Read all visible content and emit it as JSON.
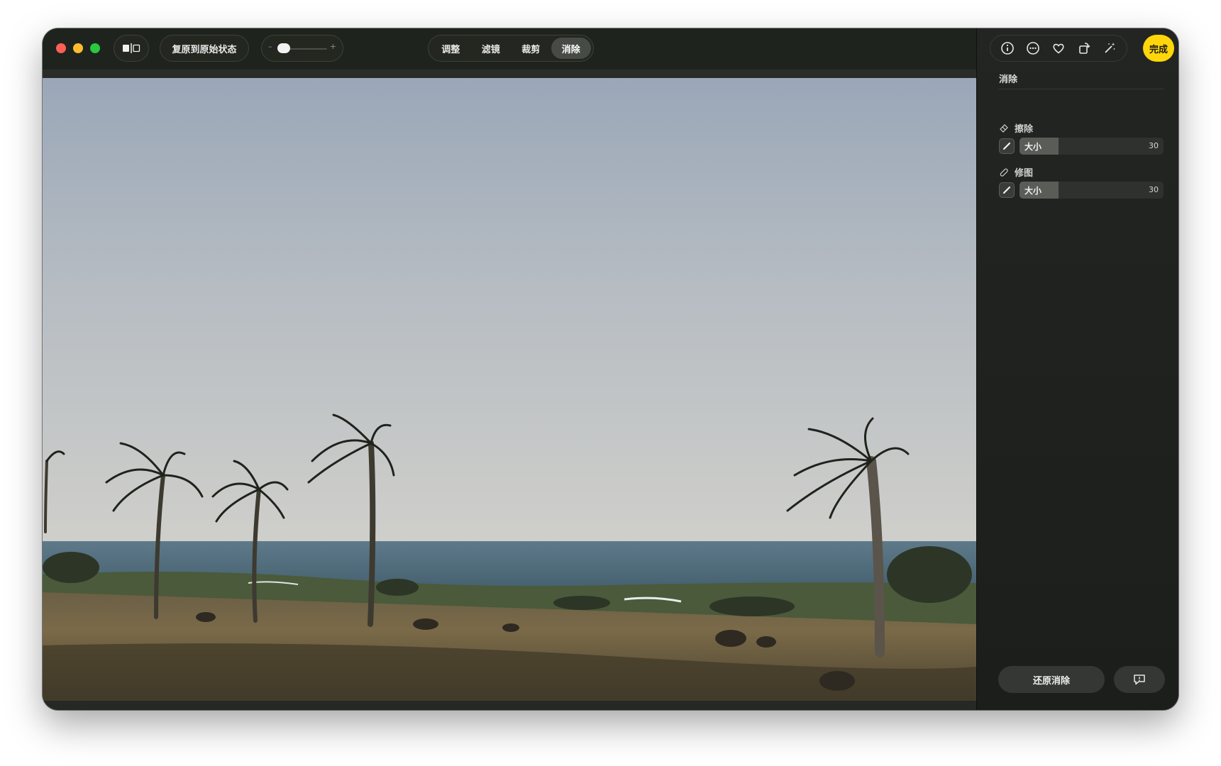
{
  "toolbar": {
    "revert_label": "复原到原始状态",
    "zoom": {
      "minus": "–",
      "plus": "+"
    },
    "tabs": [
      {
        "label": "调整",
        "active": false
      },
      {
        "label": "滤镜",
        "active": false
      },
      {
        "label": "裁剪",
        "active": false
      },
      {
        "label": "消除",
        "active": true
      }
    ]
  },
  "panel": {
    "icons": [
      "info-icon",
      "more-icon",
      "heart-icon",
      "rotate-icon",
      "magic-wand-icon"
    ],
    "done_label": "完成",
    "section_title": "消除",
    "erase": {
      "label": "擦除",
      "slider_label": "大小",
      "value": "30"
    },
    "retouch": {
      "label": "修图",
      "slider_label": "大小",
      "value": "30"
    },
    "undo_label": "还原消除"
  },
  "colors": {
    "accent": "#ffd60a",
    "window_bg": "#1d1f1d",
    "active_tab": "#474b45"
  }
}
